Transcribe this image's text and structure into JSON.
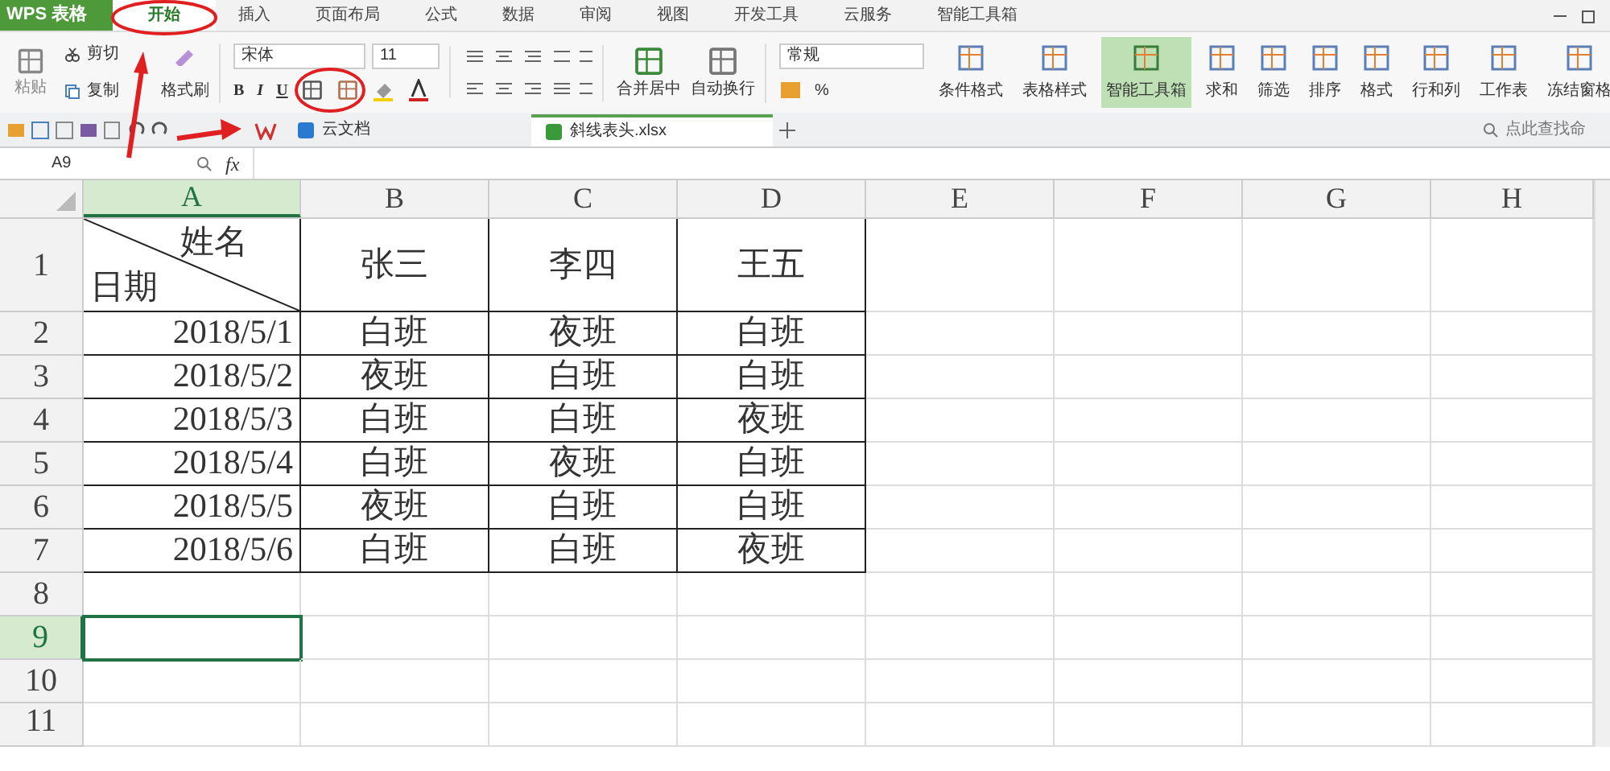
{
  "app": {
    "logo": "WPS 表格"
  },
  "menu_tabs": [
    {
      "label": "开始",
      "selected": true
    },
    {
      "label": "插入",
      "selected": false
    },
    {
      "label": "页面布局",
      "selected": false
    },
    {
      "label": "公式",
      "selected": false
    },
    {
      "label": "数据",
      "selected": false
    },
    {
      "label": "审阅",
      "selected": false
    },
    {
      "label": "视图",
      "selected": false
    },
    {
      "label": "开发工具",
      "selected": false
    },
    {
      "label": "云服务",
      "selected": false
    },
    {
      "label": "智能工具箱",
      "selected": false
    }
  ],
  "ribbon": {
    "paste": "粘贴",
    "cut": "剪切",
    "copy": "复制",
    "format_painter": "格式刷",
    "font": "宋体",
    "font_size": "11",
    "bold": "B",
    "italic": "I",
    "underline": "U",
    "merge": "合并居中",
    "wrap": "自动换行",
    "number_format": "常规",
    "percent": "%",
    "big_buttons": [
      {
        "label": "条件格式",
        "active": false
      },
      {
        "label": "表格样式",
        "active": false
      },
      {
        "label": "智能工具箱",
        "active": true
      },
      {
        "label": "求和",
        "active": false
      },
      {
        "label": "筛选",
        "active": false
      },
      {
        "label": "排序",
        "active": false
      },
      {
        "label": "格式",
        "active": false
      },
      {
        "label": "行和列",
        "active": false
      },
      {
        "label": "工作表",
        "active": false
      },
      {
        "label": "冻结窗格",
        "active": false
      }
    ]
  },
  "doc_tabs": [
    {
      "label": "云文档",
      "selected": false
    },
    {
      "label": "斜线表头.xlsx",
      "selected": true
    }
  ],
  "search": {
    "placeholder": "点此查找命"
  },
  "formula_bar": {
    "name_box": "A9",
    "fx": "fx"
  },
  "columns": [
    {
      "label": "A",
      "selected": true
    },
    {
      "label": "B",
      "selected": false
    },
    {
      "label": "C",
      "selected": false
    },
    {
      "label": "D",
      "selected": false
    },
    {
      "label": "E",
      "selected": false
    },
    {
      "label": "F",
      "selected": false
    },
    {
      "label": "G",
      "selected": false
    },
    {
      "label": "H",
      "selected": false
    }
  ],
  "rows": [
    {
      "label": "1",
      "selected": false,
      "cells": [
        {
          "kind": "diagonal",
          "top": "姓名",
          "bottom": "日期"
        },
        {
          "kind": "text",
          "text": "张三"
        },
        {
          "kind": "text",
          "text": "李四"
        },
        {
          "kind": "text",
          "text": "王五"
        }
      ]
    },
    {
      "label": "2",
      "selected": false,
      "cells": [
        {
          "kind": "date",
          "text": "2018/5/1"
        },
        {
          "kind": "text",
          "text": "白班"
        },
        {
          "kind": "text",
          "text": "夜班"
        },
        {
          "kind": "text",
          "text": "白班"
        }
      ]
    },
    {
      "label": "3",
      "selected": false,
      "cells": [
        {
          "kind": "date",
          "text": "2018/5/2"
        },
        {
          "kind": "text",
          "text": "夜班"
        },
        {
          "kind": "text",
          "text": "白班"
        },
        {
          "kind": "text",
          "text": "白班"
        }
      ]
    },
    {
      "label": "4",
      "selected": false,
      "cells": [
        {
          "kind": "date",
          "text": "2018/5/3"
        },
        {
          "kind": "text",
          "text": "白班"
        },
        {
          "kind": "text",
          "text": "白班"
        },
        {
          "kind": "text",
          "text": "夜班"
        }
      ]
    },
    {
      "label": "5",
      "selected": false,
      "cells": [
        {
          "kind": "date",
          "text": "2018/5/4"
        },
        {
          "kind": "text",
          "text": "白班"
        },
        {
          "kind": "text",
          "text": "夜班"
        },
        {
          "kind": "text",
          "text": "白班"
        }
      ]
    },
    {
      "label": "6",
      "selected": false,
      "cells": [
        {
          "kind": "date",
          "text": "2018/5/5"
        },
        {
          "kind": "text",
          "text": "夜班"
        },
        {
          "kind": "text",
          "text": "白班"
        },
        {
          "kind": "text",
          "text": "白班"
        }
      ]
    },
    {
      "label": "7",
      "selected": false,
      "cells": [
        {
          "kind": "date",
          "text": "2018/5/6"
        },
        {
          "kind": "text",
          "text": "白班"
        },
        {
          "kind": "text",
          "text": "白班"
        },
        {
          "kind": "text",
          "text": "夜班"
        }
      ]
    },
    {
      "label": "8",
      "selected": false,
      "cells": []
    },
    {
      "label": "9",
      "selected": true,
      "cells": []
    },
    {
      "label": "10",
      "selected": false,
      "cells": []
    },
    {
      "label": "11",
      "selected": false,
      "cells": []
    }
  ]
}
